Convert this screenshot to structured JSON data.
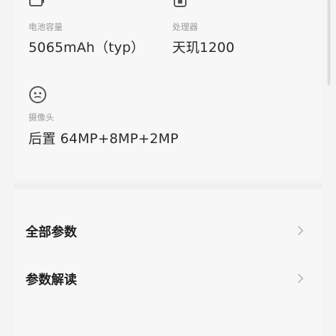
{
  "specs": [
    {
      "icon": "battery-icon",
      "label": "电池容量",
      "value": "5065mAh（typ）"
    },
    {
      "icon": "processor-icon",
      "label": "处理器",
      "value": "天玑1200"
    },
    {
      "icon": "camera-icon",
      "label": "摄像头",
      "value": "后置 64MP+8MP+2MP"
    }
  ],
  "menu": {
    "items": [
      {
        "label": "全部参数",
        "icon": "chevron-right-icon"
      },
      {
        "label": "参数解读",
        "icon": "chevron-right-icon"
      }
    ]
  }
}
